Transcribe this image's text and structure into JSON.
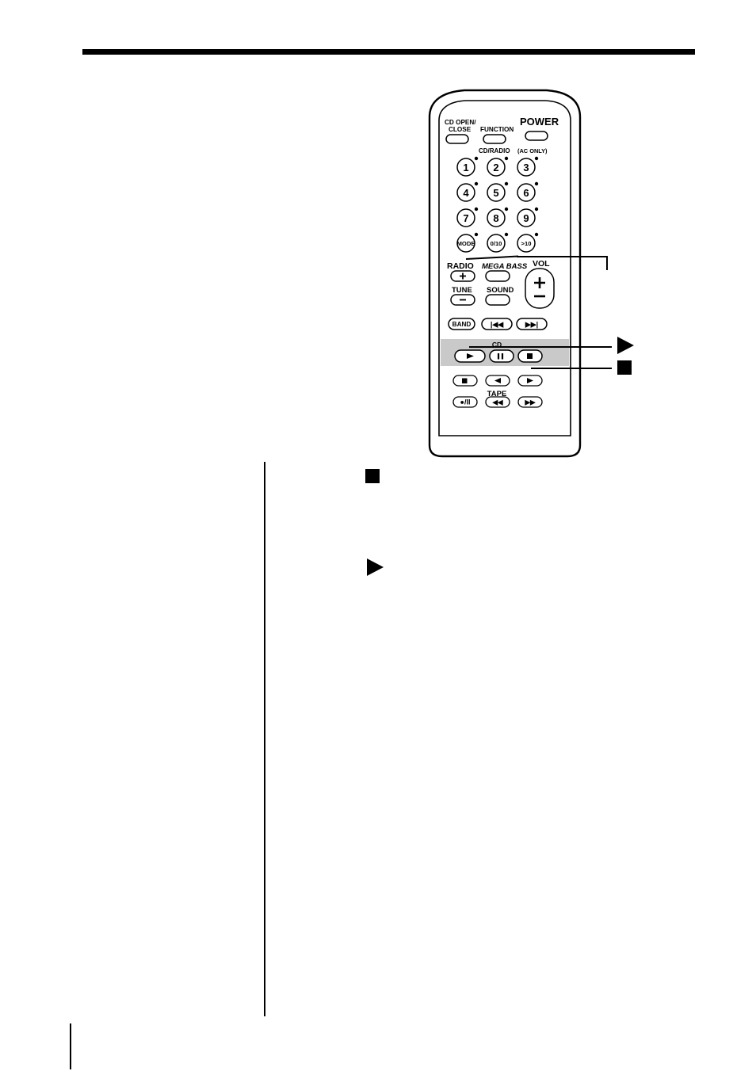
{
  "page": {
    "figure_caption": "",
    "marks": {
      "stop_square": "■",
      "play_triangle": "▶"
    }
  },
  "remote": {
    "title": "remote control illustration",
    "labels": {
      "cd_open_close_line1": "CD OPEN/",
      "cd_open_close_line2": "CLOSE",
      "function": "FUNCTION",
      "power": "POWER",
      "cd_radio": "CD/RADIO",
      "ac_only": "(AC ONLY)",
      "radio": "RADIO",
      "mega_bass": "MEGA BASS",
      "vol": "VOL",
      "tune": "TUNE",
      "sound": "SOUND",
      "band": "BAND",
      "cd": "CD",
      "tape": "TAPE",
      "mode": "MODE",
      "ten_key_0_10": "0/10",
      "ten_key_over_10": ">10",
      "vol_plus": "+",
      "vol_minus": "–",
      "tune_plus": "+",
      "tune_minus": "–",
      "rec_pause": "●/II",
      "prev": "|◀◀",
      "next": "▶▶|",
      "rew": "◀◀",
      "ff": "▶▶",
      "play": "▶",
      "pause": "II",
      "stop": "■",
      "tape_stop": "■",
      "tape_rev": "◀",
      "tape_fwd": "▶"
    },
    "number_keys": [
      "1",
      "2",
      "3",
      "4",
      "5",
      "6",
      "7",
      "8",
      "9"
    ]
  },
  "colors": {
    "ink": "#000000",
    "paper": "#ffffff",
    "highlight_band": "#c9c9c9",
    "remote_body": "#ffffff",
    "button_fill": "#ffffff"
  }
}
